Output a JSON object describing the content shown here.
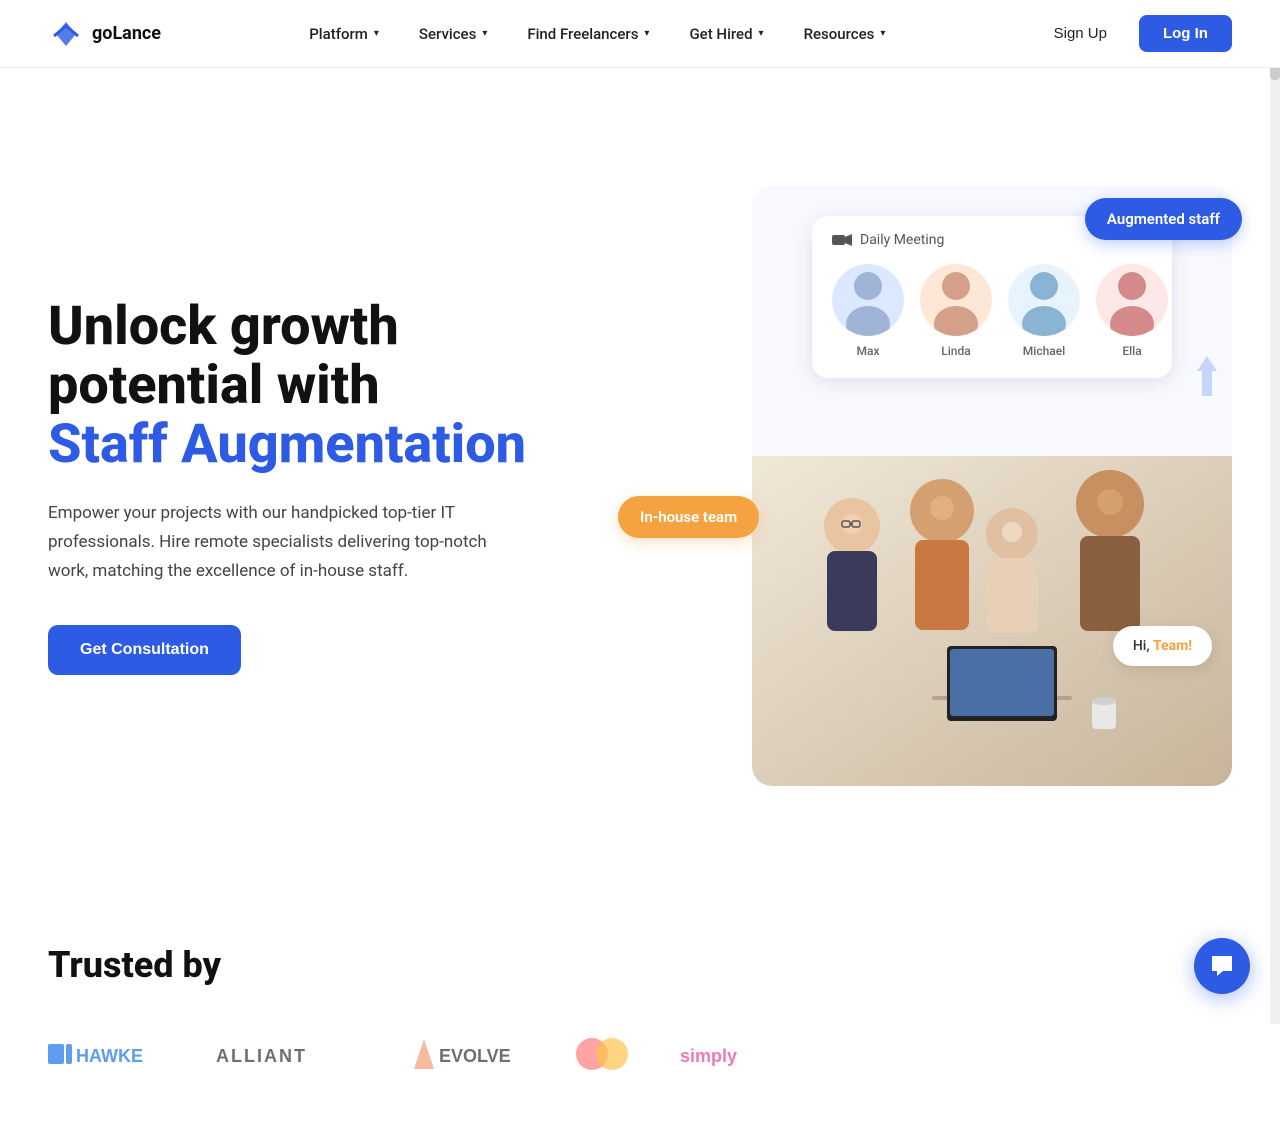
{
  "brand": {
    "name": "goLance",
    "logo_text": "goLance"
  },
  "nav": {
    "links": [
      {
        "id": "platform",
        "label": "Platform"
      },
      {
        "id": "services",
        "label": "Services"
      },
      {
        "id": "find-freelancers",
        "label": "Find Freelancers"
      },
      {
        "id": "get-hired",
        "label": "Get Hired"
      },
      {
        "id": "resources",
        "label": "Resources"
      }
    ],
    "signup_label": "Sign Up",
    "login_label": "Log In"
  },
  "hero": {
    "heading_line1": "Unlock growth",
    "heading_line2": "potential with",
    "heading_accent": "Staff Augmentation",
    "subtext": "Empower your projects with our handpicked top-tier IT professionals. Hire remote specialists delivering top-notch work, matching the excellence of in-house staff.",
    "cta_label": "Get Consultation",
    "badge_augmented": "Augmented staff",
    "badge_inhouse": "In-house team",
    "daily_meeting_label": "Daily Meeting",
    "team_members": [
      {
        "name": "Max",
        "emoji": "👨"
      },
      {
        "name": "Linda",
        "emoji": "👩"
      },
      {
        "name": "Michael",
        "emoji": "👨‍💼"
      },
      {
        "name": "Ella",
        "emoji": "👩‍🦱"
      }
    ],
    "hi_team_text": "Hi, ",
    "hi_team_accent": "Team!"
  },
  "trusted": {
    "heading": "Trusted by"
  },
  "colors": {
    "primary": "#2d5be3",
    "accent_orange": "#f4a340",
    "text_dark": "#111111",
    "text_muted": "#444444"
  }
}
